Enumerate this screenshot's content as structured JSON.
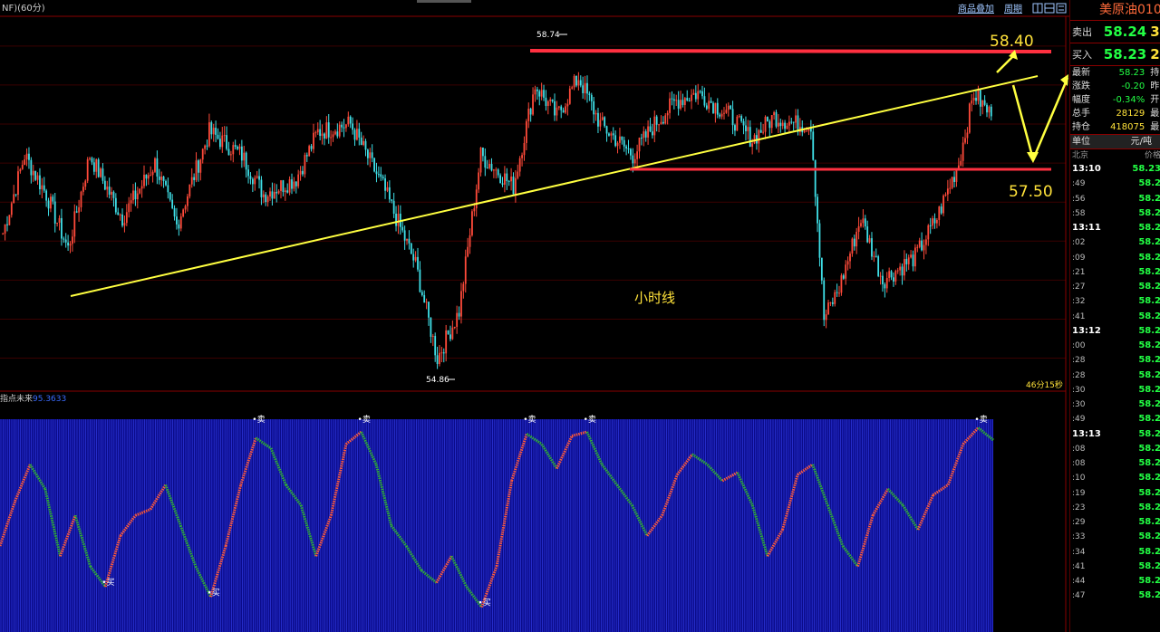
{
  "toolbar": {
    "title_fragment": "NF)(60分)",
    "overlay_label": "商品叠加",
    "period_label": "周期",
    "icons": [
      "grid-icon",
      "window-icon",
      "list-icon"
    ]
  },
  "main_chart": {
    "high_label": "58.74",
    "low_label": "54.86",
    "caption": "小时线",
    "resistance_label": "58.40",
    "support_label": "57.50",
    "countdown": "46分15秒",
    "colors": {
      "up": "#ff4a3a",
      "down": "#3fe0e8",
      "trend": "#ffff40",
      "level": "#ff3040",
      "annotation": "#ffe23a"
    }
  },
  "indicator": {
    "title": "指点未来",
    "value": "95.3633",
    "sell_marker": "卖",
    "buy_marker": "买",
    "colors": {
      "bg": "#0b0b8a",
      "up": "#ff5a3a",
      "down": "#2fb030"
    }
  },
  "chart_data": [
    {
      "type": "candlestick",
      "title": "小时线",
      "ylim": [
        54.6,
        59.3
      ],
      "annotations": [
        {
          "text": "58.74",
          "y": 58.74
        },
        {
          "text": "54.86",
          "y": 54.86
        },
        {
          "text": "58.40",
          "y": 58.4
        },
        {
          "text": "57.50",
          "y": 57.5
        }
      ],
      "horizontal_lines": [
        58.4,
        57.5
      ],
      "close_path": [
        {
          "i": 0,
          "y": 56.6
        },
        {
          "i": 10,
          "y": 57.6
        },
        {
          "i": 20,
          "y": 57.1
        },
        {
          "i": 30,
          "y": 56.4
        },
        {
          "i": 40,
          "y": 57.6
        },
        {
          "i": 55,
          "y": 56.8
        },
        {
          "i": 70,
          "y": 57.5
        },
        {
          "i": 80,
          "y": 56.7
        },
        {
          "i": 95,
          "y": 57.9
        },
        {
          "i": 110,
          "y": 57.6
        },
        {
          "i": 120,
          "y": 57.1
        },
        {
          "i": 135,
          "y": 57.3
        },
        {
          "i": 145,
          "y": 57.9
        },
        {
          "i": 160,
          "y": 58.0
        },
        {
          "i": 175,
          "y": 57.2
        },
        {
          "i": 190,
          "y": 56.2
        },
        {
          "i": 200,
          "y": 55.0
        },
        {
          "i": 210,
          "y": 55.6
        },
        {
          "i": 220,
          "y": 57.6
        },
        {
          "i": 235,
          "y": 57.2
        },
        {
          "i": 245,
          "y": 58.5
        },
        {
          "i": 255,
          "y": 58.1
        },
        {
          "i": 265,
          "y": 58.6
        },
        {
          "i": 275,
          "y": 58.0
        },
        {
          "i": 290,
          "y": 57.6
        },
        {
          "i": 300,
          "y": 58.0
        },
        {
          "i": 310,
          "y": 58.3
        },
        {
          "i": 320,
          "y": 58.4
        },
        {
          "i": 335,
          "y": 58.1
        },
        {
          "i": 345,
          "y": 57.8
        },
        {
          "i": 355,
          "y": 58.1
        },
        {
          "i": 365,
          "y": 58.0
        },
        {
          "i": 372,
          "y": 58.0
        },
        {
          "i": 378,
          "y": 55.5
        },
        {
          "i": 385,
          "y": 55.9
        },
        {
          "i": 395,
          "y": 56.8
        },
        {
          "i": 405,
          "y": 56.0
        },
        {
          "i": 420,
          "y": 56.3
        },
        {
          "i": 430,
          "y": 56.8
        },
        {
          "i": 440,
          "y": 57.5
        },
        {
          "i": 447,
          "y": 58.4
        },
        {
          "i": 455,
          "y": 58.1
        }
      ]
    },
    {
      "type": "line",
      "title": "指点未来",
      "ylim": [
        0,
        100
      ],
      "values": [
        40,
        62,
        80,
        68,
        35,
        55,
        30,
        20,
        45,
        55,
        58,
        70,
        50,
        30,
        15,
        40,
        70,
        93,
        88,
        70,
        60,
        35,
        55,
        90,
        96,
        80,
        50,
        40,
        28,
        22,
        35,
        20,
        10,
        30,
        72,
        95,
        90,
        78,
        94,
        96,
        80,
        70,
        60,
        45,
        55,
        75,
        85,
        80,
        72,
        76,
        60,
        35,
        48,
        75,
        80,
        60,
        40,
        30,
        55,
        68,
        60,
        48,
        65,
        70,
        90,
        98,
        92
      ],
      "last_value": 95.3633
    }
  ],
  "sidebar": {
    "title": "美原油010",
    "sell_label": "卖出",
    "sell_price": "58.24",
    "sell_qty": "3",
    "buy_label": "买入",
    "buy_price": "58.23",
    "buy_qty": "2",
    "stats": [
      {
        "label": "最新",
        "value": "58.23",
        "ext": "持",
        "color": "#22ff44"
      },
      {
        "label": "涨跌",
        "value": "-0.20",
        "ext": "昨",
        "color": "#22ff44"
      },
      {
        "label": "幅度",
        "value": "-0.34%",
        "ext": "开",
        "color": "#22ff44"
      },
      {
        "label": "总手",
        "value": "28129",
        "ext": "最",
        "color": "#ffe23a"
      },
      {
        "label": "持仓",
        "value": "418075",
        "ext": "最",
        "color": "#ffe23a"
      }
    ],
    "unit_label": "单位",
    "unit_value": "元/吨",
    "list_header_time": "北京",
    "list_header_price": "价格",
    "ticks": [
      {
        "t": "13:10",
        "p": "58.23",
        "hour": true
      },
      {
        "t": ":49",
        "p": "58.2"
      },
      {
        "t": ":56",
        "p": "58.2"
      },
      {
        "t": ":58",
        "p": "58.2"
      },
      {
        "t": "13:11",
        "p": "58.2",
        "hour": true
      },
      {
        "t": ":02",
        "p": "58.2"
      },
      {
        "t": ":09",
        "p": "58.2"
      },
      {
        "t": ":21",
        "p": "58.2"
      },
      {
        "t": ":27",
        "p": "58.2"
      },
      {
        "t": ":32",
        "p": "58.2"
      },
      {
        "t": ":41",
        "p": "58.2"
      },
      {
        "t": "13:12",
        "p": "58.2",
        "hour": true
      },
      {
        "t": ":00",
        "p": "58.2"
      },
      {
        "t": ":28",
        "p": "58.2"
      },
      {
        "t": ":28",
        "p": "58.2"
      },
      {
        "t": ":30",
        "p": "58.2"
      },
      {
        "t": ":30",
        "p": "58.2"
      },
      {
        "t": ":49",
        "p": "58.2"
      },
      {
        "t": "13:13",
        "p": "58.2",
        "hour": true
      },
      {
        "t": ":08",
        "p": "58.2"
      },
      {
        "t": ":08",
        "p": "58.2"
      },
      {
        "t": ":10",
        "p": "58.2"
      },
      {
        "t": ":19",
        "p": "58.2"
      },
      {
        "t": ":23",
        "p": "58.2"
      },
      {
        "t": ":29",
        "p": "58.2"
      },
      {
        "t": ":33",
        "p": "58.2"
      },
      {
        "t": ":34",
        "p": "58.2"
      },
      {
        "t": ":41",
        "p": "58.2"
      },
      {
        "t": ":44",
        "p": "58.2"
      },
      {
        "t": ":47",
        "p": "58.2"
      }
    ]
  }
}
